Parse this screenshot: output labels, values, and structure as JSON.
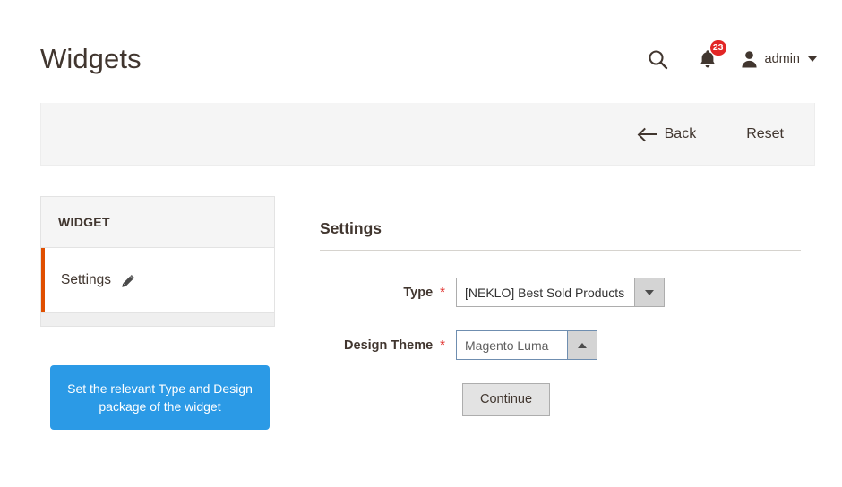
{
  "header": {
    "title": "Widgets",
    "search_icon": "search-icon",
    "notifications": {
      "icon": "bell-icon",
      "count": "23"
    },
    "user": {
      "avatar_icon": "user-avatar-icon",
      "name": "admin",
      "caret_icon": "caret-down-icon"
    }
  },
  "action_bar": {
    "back_label": "Back",
    "back_icon": "arrow-left-icon",
    "reset_label": "Reset"
  },
  "sidebar": {
    "header_title": "WIDGET",
    "items": [
      {
        "label": "Settings",
        "icon": "pencil-edit-icon",
        "active": true
      }
    ],
    "callout": "Set the relevant Type and Design package of the widget"
  },
  "form": {
    "section_title": "Settings",
    "required_marker": "*",
    "fields": [
      {
        "label": "Type",
        "value": "[NEKLO] Best Sold Products",
        "required": true,
        "arrow_icon": "chevron-down-icon",
        "state": "closed"
      },
      {
        "label": "Design Theme",
        "value": "Magento Luma",
        "required": true,
        "arrow_icon": "chevron-up-icon",
        "state": "open"
      }
    ],
    "continue_label": "Continue"
  },
  "colors": {
    "accent_orange": "#e04f00",
    "badge_red": "#e22626",
    "callout_blue": "#2b9ae6",
    "required_red": "#e02b27",
    "toolbar_gray": "#f5f5f5",
    "text_dark": "#41362f"
  }
}
